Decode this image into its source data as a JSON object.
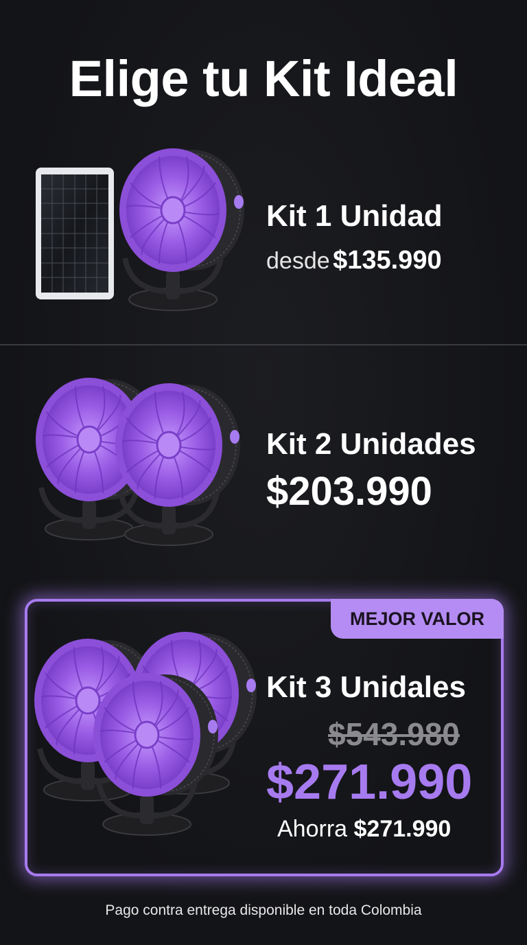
{
  "title": "Elige tu Kit Ideal",
  "kits": [
    {
      "name": "Kit 1 Unidad",
      "price_prefix": "desde",
      "price": "$135.990"
    },
    {
      "name": "Kit 2 Unidades",
      "price": "$203.990"
    },
    {
      "name": "Kit 3 Unidales",
      "badge": "MEJOR VALOR",
      "old_price": "$543.980",
      "price": "$271.990",
      "savings_prefix": "Ahorra",
      "savings": "$271.990"
    }
  ],
  "footer": "Pago contra entrega disponible en toda Colombia",
  "colors": {
    "background": "#141518",
    "accent": "#a77bf0",
    "fan_purple": "#9b5de5",
    "fan_body": "#2b2b2f"
  },
  "icons": [
    "solar-panel-icon",
    "fan-icon"
  ]
}
